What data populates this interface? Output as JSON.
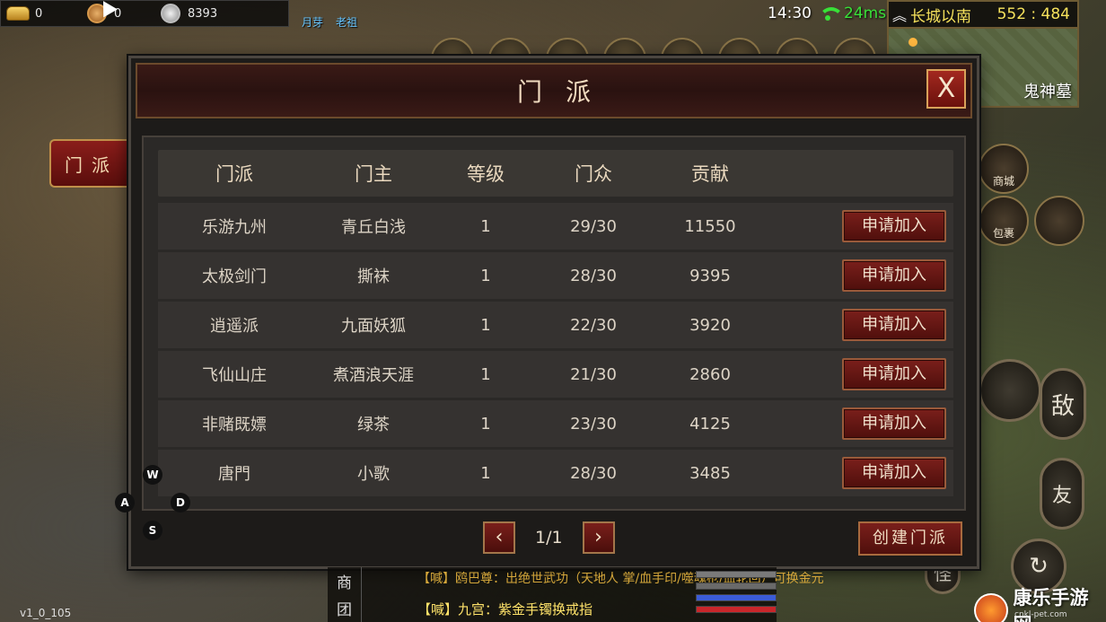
{
  "resources": [
    {
      "icon": "gold-ingot-icon",
      "value": "0"
    },
    {
      "icon": "copper-coin-icon",
      "value": "0"
    },
    {
      "icon": "silver-coin-icon",
      "value": "8393"
    }
  ],
  "status": {
    "time": "14:30",
    "ping": "24ms"
  },
  "map": {
    "region": "长城以南",
    "coords": "552 : 484",
    "place": "鬼神墓"
  },
  "npc": {
    "label_1": "月芽",
    "label_2": "老祖"
  },
  "side_tab": {
    "label": "门派"
  },
  "panel": {
    "title": "门派",
    "close_label": "X",
    "headers": [
      "门派",
      "门主",
      "等级",
      "门众",
      "贡献"
    ],
    "rows": [
      {
        "name": "乐游九州",
        "leader": "青丘白浅",
        "level": "1",
        "members": "29/30",
        "contribution": "11550",
        "action": "申请加入"
      },
      {
        "name": "太极剑门",
        "leader": "撕袜",
        "level": "1",
        "members": "28/30",
        "contribution": "9395",
        "action": "申请加入"
      },
      {
        "name": "逍遥派",
        "leader": "九面妖狐",
        "level": "1",
        "members": "22/30",
        "contribution": "3920",
        "action": "申请加入"
      },
      {
        "name": "飞仙山庄",
        "leader": "煮酒浪天涯",
        "level": "1",
        "members": "21/30",
        "contribution": "2860",
        "action": "申请加入"
      },
      {
        "name": "非赌既嫖",
        "leader": "绿茶",
        "level": "1",
        "members": "23/30",
        "contribution": "4125",
        "action": "申请加入"
      },
      {
        "name": "唐門",
        "leader": "小歌",
        "level": "1",
        "members": "28/30",
        "contribution": "3485",
        "action": "申请加入"
      }
    ],
    "pager": {
      "prev": "‹",
      "page": "1/1",
      "next": "›"
    },
    "create_label": "创建门派"
  },
  "right_buttons": {
    "shop": "商城",
    "bag": "包裹",
    "enemy": "敌",
    "friend": "友",
    "monster": "怪"
  },
  "keys": {
    "w": "W",
    "a": "A",
    "s": "S",
    "d": "D"
  },
  "chat": {
    "tabs": [
      "商",
      "团"
    ],
    "line_1": "【喊】鸥巴尊：出绝世武功（天地人 掌/血手印/噬魂枪/血轮回）可换金元",
    "line_2": "【喊】九宫：紫金手镯换戒指"
  },
  "version": "v1_0_105",
  "watermark": {
    "title": "康乐手游网",
    "sub": "cnkl-pet.com"
  }
}
